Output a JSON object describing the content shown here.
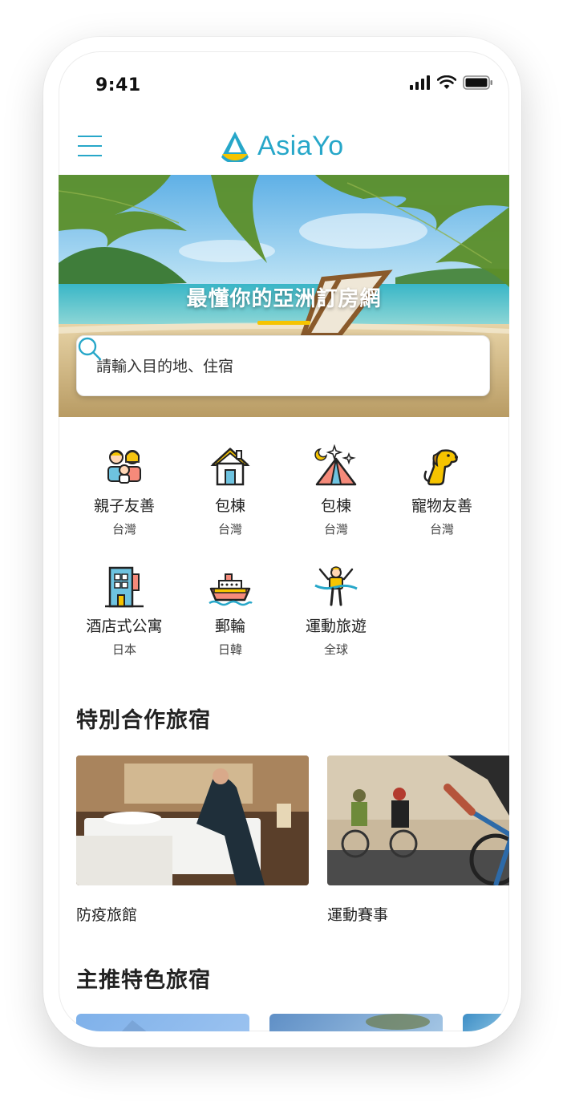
{
  "status_bar": {
    "time": "9:41"
  },
  "header": {
    "brand": "AsiaYo"
  },
  "hero": {
    "title": "最懂你的亞洲訂房網",
    "search_placeholder": "請輸入目的地、住宿"
  },
  "categories": [
    {
      "label": "親子友善",
      "sub": "台灣",
      "icon": "family-icon"
    },
    {
      "label": "包棟",
      "sub": "台灣",
      "icon": "house-icon"
    },
    {
      "label": "包棟",
      "sub": "台灣",
      "icon": "camping-tent-icon"
    },
    {
      "label": "寵物友善",
      "sub": "台灣",
      "icon": "dog-icon"
    },
    {
      "label": "酒店式公寓",
      "sub": "日本",
      "icon": "apartment-building-icon"
    },
    {
      "label": "郵輪",
      "sub": "日韓",
      "icon": "cruise-ship-icon"
    },
    {
      "label": "運動旅遊",
      "sub": "全球",
      "icon": "runner-finish-icon"
    }
  ],
  "special": {
    "title": "特別合作旅宿",
    "cards": [
      {
        "label": "防疫旅館"
      },
      {
        "label": "運動賽事"
      }
    ]
  },
  "featured": {
    "title": "主推特色旅宿"
  },
  "colors": {
    "brand": "#27a7c9",
    "accent_yellow": "#f6c400"
  }
}
